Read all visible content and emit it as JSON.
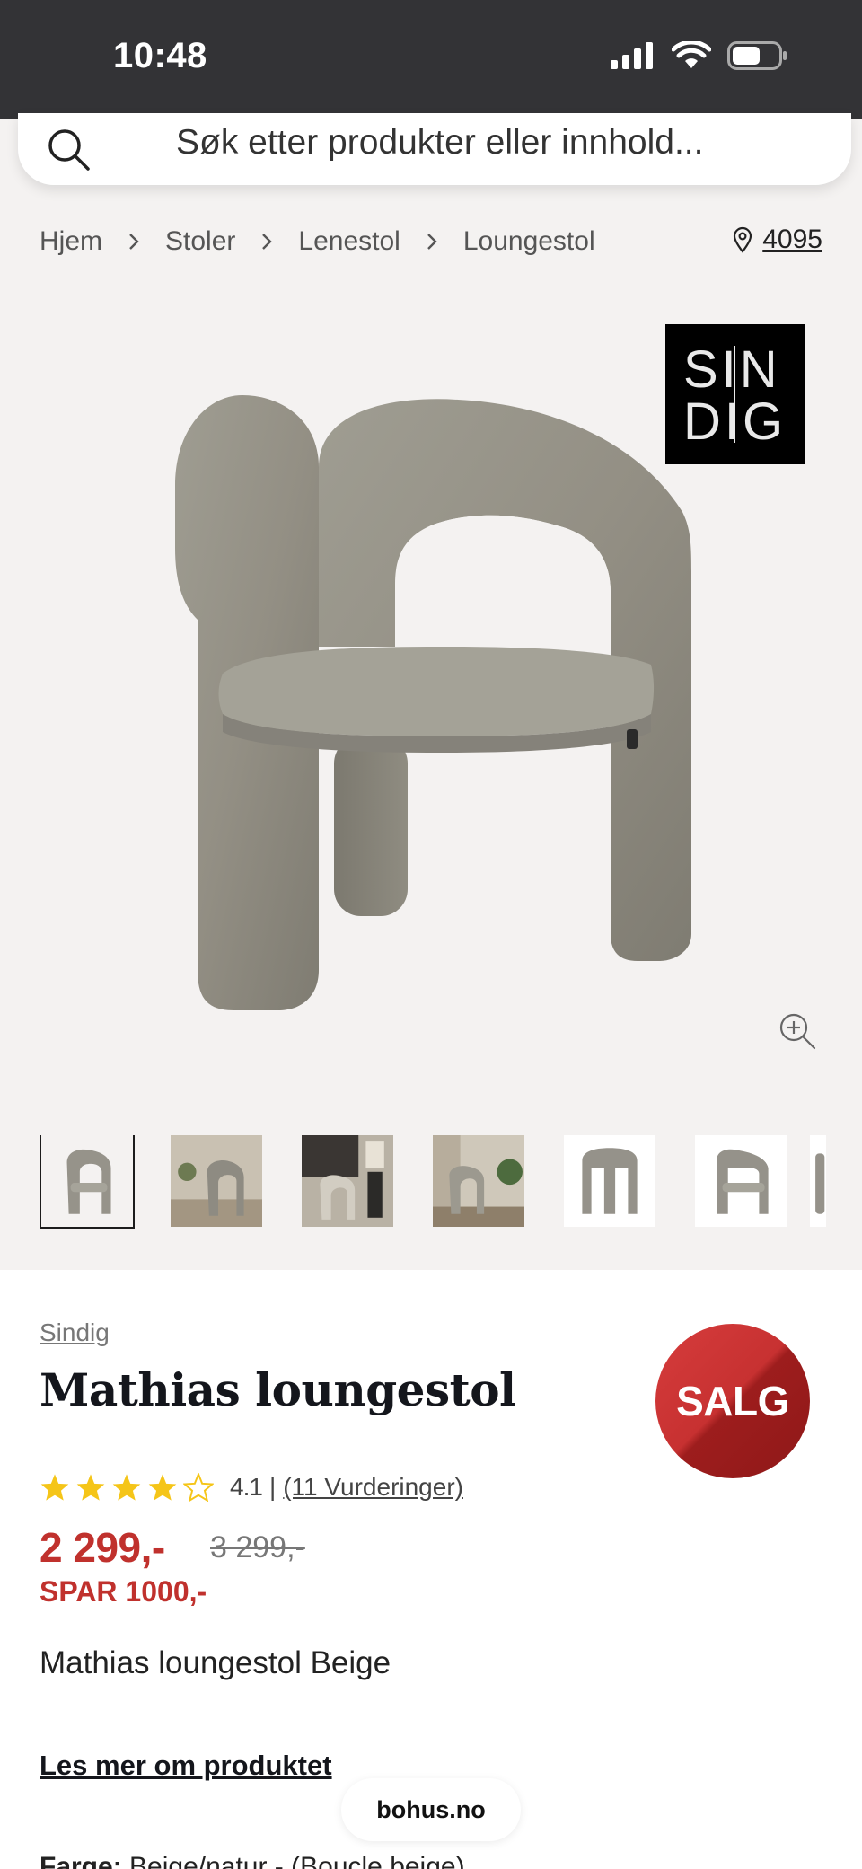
{
  "status_bar": {
    "time": "10:48"
  },
  "search": {
    "placeholder": "Søk etter produkter eller innhold..."
  },
  "breadcrumb": [
    "Hjem",
    "Stoler",
    "Lenestol",
    "Loungestol"
  ],
  "location": {
    "postcode": "4095"
  },
  "brand_logo": {
    "line1": "SIN",
    "line2": "DIG"
  },
  "product": {
    "brand": "Sindig",
    "title": "Mathias loungestol",
    "badge": "SALG",
    "rating": {
      "value": 4.1,
      "value_text": "4.1",
      "stars_filled": 4,
      "stars_total": 5,
      "reviews_text": "(11 Vurderinger)"
    },
    "price": "2 299,-",
    "old_price": "3 299,-",
    "saving": "SPAR 1000,-",
    "description": "Mathias loungestol Beige",
    "read_more": "Les mer om produktet",
    "color_label": "Farge:",
    "color_value": "Beige/natur - (Boucle beige)"
  },
  "thumbnails": [
    "chair-front",
    "chair-room-1",
    "chair-room-2",
    "chair-room-3",
    "chair-back",
    "chair-side",
    "chair-partial"
  ],
  "footer_pill": {
    "domain": "bohus.no"
  },
  "colors": {
    "sale_red": "#c0312d",
    "status_bg": "#333336",
    "gallery_bg": "#f4f2f1"
  }
}
